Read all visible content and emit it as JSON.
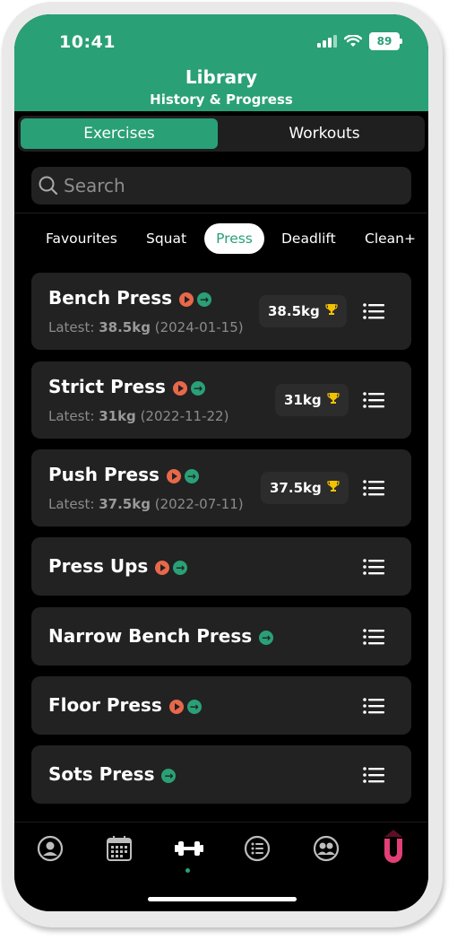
{
  "status": {
    "time": "10:41",
    "battery": "89"
  },
  "header": {
    "title": "Library",
    "subtitle": "History & Progress"
  },
  "segments": {
    "active": "Exercises",
    "inactive": "Workouts"
  },
  "search": {
    "placeholder": "Search"
  },
  "filters": [
    "Favourites",
    "Squat",
    "Press",
    "Deadlift",
    "Clean+"
  ],
  "active_filter": "Press",
  "exercises": [
    {
      "name": "Bench Press",
      "latest_label": "Latest:",
      "latest_value": "38.5kg",
      "latest_date": "(2024-01-15)",
      "pr": "38.5kg"
    },
    {
      "name": "Strict Press",
      "latest_label": "Latest:",
      "latest_value": "31kg",
      "latest_date": "(2022-11-22)",
      "pr": "31kg"
    },
    {
      "name": "Push Press",
      "latest_label": "Latest:",
      "latest_value": "37.5kg",
      "latest_date": "(2022-07-11)",
      "pr": "37.5kg"
    },
    {
      "name": "Press Ups"
    },
    {
      "name": "Narrow Bench Press"
    },
    {
      "name": "Floor Press"
    },
    {
      "name": "Sots Press"
    }
  ],
  "colors": {
    "accent": "#2aa077",
    "play": "#e8684a",
    "trophy": "#f2c200",
    "brand": "#e23f76"
  }
}
